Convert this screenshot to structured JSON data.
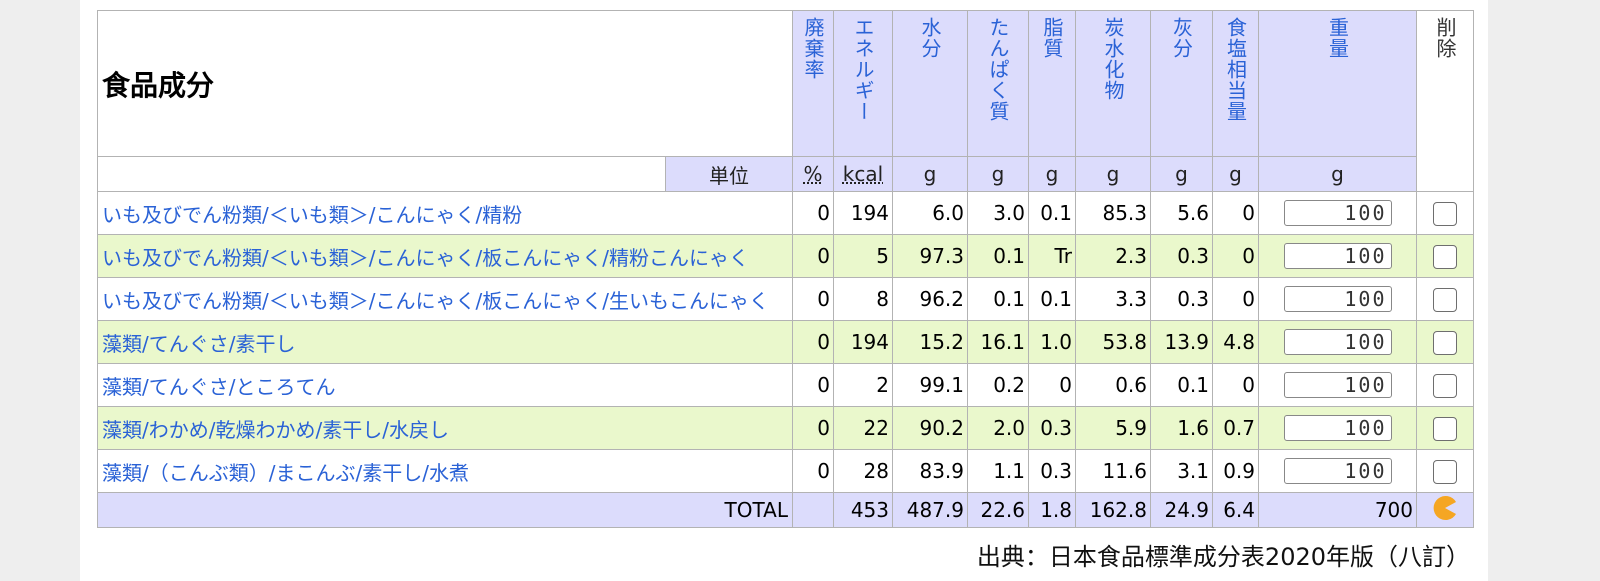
{
  "table": {
    "title": "食品成分",
    "unit_label": "単位",
    "headers": [
      "廃棄率",
      "エネルギー",
      "水分",
      "たんぱく質",
      "脂質",
      "炭水化物",
      "灰分",
      "食塩相当量",
      "重量",
      "削除"
    ],
    "units": [
      "%",
      "kcal",
      "g",
      "g",
      "g",
      "g",
      "g",
      "g",
      "g"
    ],
    "rows": [
      {
        "name": "いも及びでん粉類/＜いも類＞/こんにゃく/精粉",
        "refuse": "0",
        "energy": "194",
        "water": "6.0",
        "protein": "3.0",
        "fat": "0.1",
        "carb": "85.3",
        "ash": "5.6",
        "salt": "0",
        "weight": "100"
      },
      {
        "name": "いも及びでん粉類/＜いも類＞/こんにゃく/板こんにゃく/精粉こんにゃく",
        "refuse": "0",
        "energy": "5",
        "water": "97.3",
        "protein": "0.1",
        "fat": "Tr",
        "carb": "2.3",
        "ash": "0.3",
        "salt": "0",
        "weight": "100"
      },
      {
        "name": "いも及びでん粉類/＜いも類＞/こんにゃく/板こんにゃく/生いもこんにゃく",
        "refuse": "0",
        "energy": "8",
        "water": "96.2",
        "protein": "0.1",
        "fat": "0.1",
        "carb": "3.3",
        "ash": "0.3",
        "salt": "0",
        "weight": "100"
      },
      {
        "name": "藻類/てんぐさ/素干し",
        "refuse": "0",
        "energy": "194",
        "water": "15.2",
        "protein": "16.1",
        "fat": "1.0",
        "carb": "53.8",
        "ash": "13.9",
        "salt": "4.8",
        "weight": "100"
      },
      {
        "name": "藻類/てんぐさ/ところてん",
        "refuse": "0",
        "energy": "2",
        "water": "99.1",
        "protein": "0.2",
        "fat": "0",
        "carb": "0.6",
        "ash": "0.1",
        "salt": "0",
        "weight": "100"
      },
      {
        "name": "藻類/わかめ/乾燥わかめ/素干し/水戻し",
        "refuse": "0",
        "energy": "22",
        "water": "90.2",
        "protein": "2.0",
        "fat": "0.3",
        "carb": "5.9",
        "ash": "1.6",
        "salt": "0.7",
        "weight": "100"
      },
      {
        "name": "藻類/（こんぶ類）/まこんぶ/素干し/水煮",
        "refuse": "0",
        "energy": "28",
        "water": "83.9",
        "protein": "1.1",
        "fat": "0.3",
        "carb": "11.6",
        "ash": "3.1",
        "salt": "0.9",
        "weight": "100"
      }
    ],
    "total": {
      "label": "TOTAL",
      "energy": "453",
      "water": "487.9",
      "protein": "22.6",
      "fat": "1.8",
      "carb": "162.8",
      "ash": "24.9",
      "salt": "6.4",
      "weight": "700"
    }
  },
  "icons": {
    "total_action": "pacman-icon"
  },
  "colors": {
    "header_bg": "#dcdcfc",
    "odd_row_bg": "#eaf8cc",
    "link": "#2a62d6",
    "accent": "#f5a623"
  },
  "source": "出典：日本食品標準成分表2020年版（八訂）"
}
